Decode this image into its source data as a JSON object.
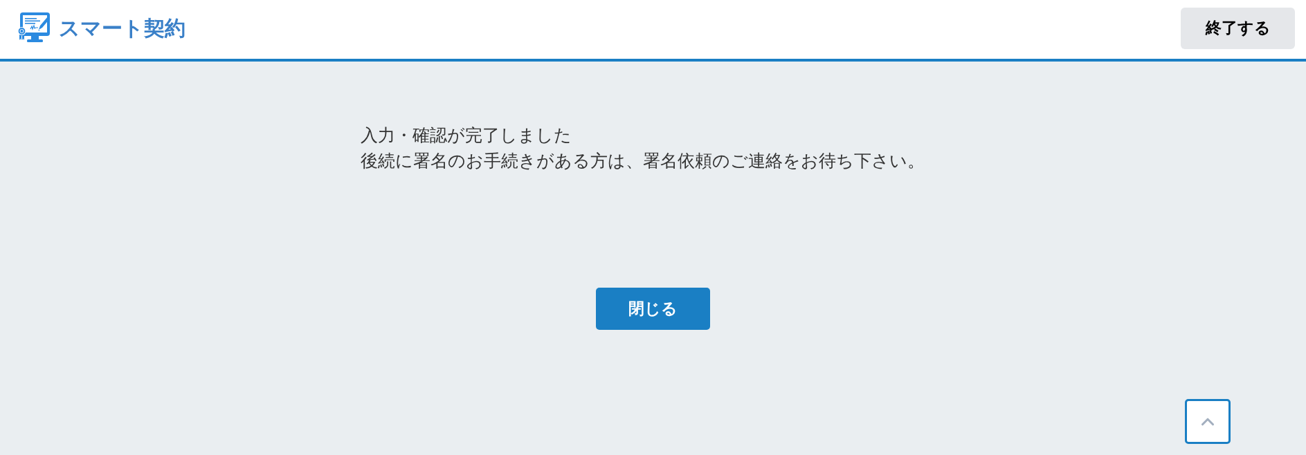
{
  "header": {
    "logo_text": "スマート契約",
    "end_button": "終了する"
  },
  "message": {
    "title": "入力・確認が完了しました",
    "body": "後続に署名のお手続きがある方は、署名依頼のご連絡をお待ち下さい。"
  },
  "close_button": "閉じる"
}
